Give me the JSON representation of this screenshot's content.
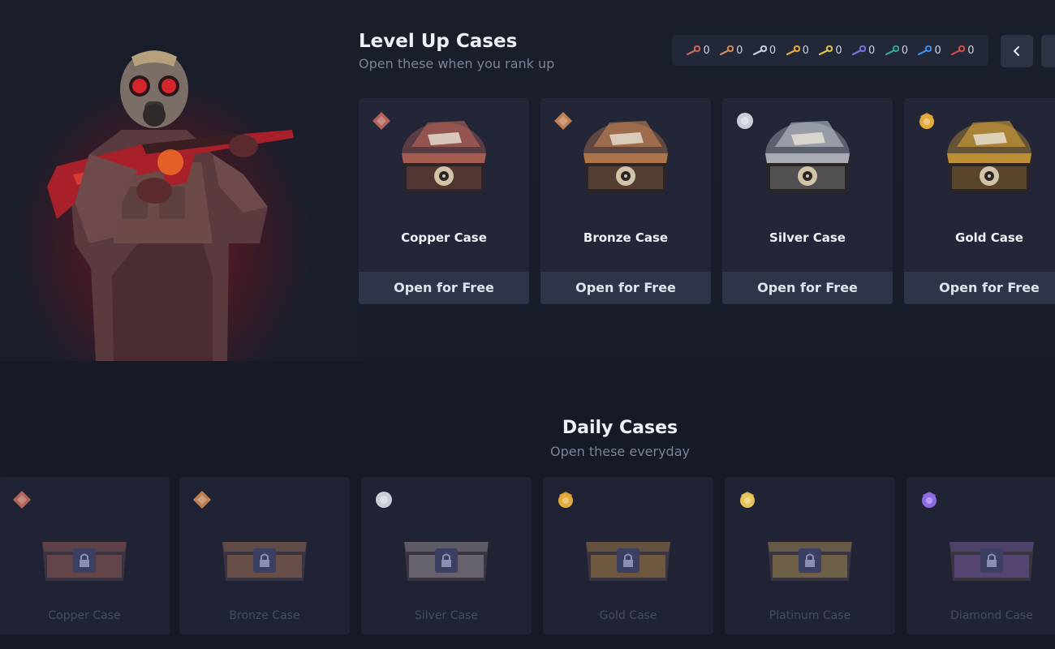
{
  "level_up": {
    "title": "Level Up Cases",
    "subtitle": "Open these when you rank up",
    "cases": [
      {
        "name": "Copper Case",
        "button": "Open for Free",
        "color": "#c46a5c"
      },
      {
        "name": "Bronze Case",
        "button": "Open for Free",
        "color": "#d08a55"
      },
      {
        "name": "Silver Case",
        "button": "Open for Free",
        "color": "#c9ced8"
      },
      {
        "name": "Gold Case",
        "button": "Open for Free",
        "color": "#e3a93a"
      }
    ]
  },
  "keys": [
    {
      "count": "0",
      "color": "#c4675a"
    },
    {
      "count": "0",
      "color": "#d08a55"
    },
    {
      "count": "0",
      "color": "#c9ced8"
    },
    {
      "count": "0",
      "color": "#e3a93a"
    },
    {
      "count": "0",
      "color": "#d9c24a"
    },
    {
      "count": "0",
      "color": "#7d6be0"
    },
    {
      "count": "0",
      "color": "#2fa88a"
    },
    {
      "count": "0",
      "color": "#3b8de0"
    },
    {
      "count": "0",
      "color": "#d24b45"
    }
  ],
  "daily": {
    "title": "Daily Cases",
    "subtitle": "Open these everyday",
    "cases": [
      {
        "name": "Copper Case",
        "color": "#c46a5c"
      },
      {
        "name": "Bronze Case",
        "color": "#d08a55"
      },
      {
        "name": "Silver Case",
        "color": "#c9ced8"
      },
      {
        "name": "Gold Case",
        "color": "#e3a93a"
      },
      {
        "name": "Platinum Case",
        "color": "#e8c55a"
      },
      {
        "name": "Diamond Case",
        "color": "#8e6be6"
      }
    ]
  },
  "icons": {
    "back": "chevron-left-icon",
    "lock": "lock-icon",
    "key": "key-icon"
  }
}
